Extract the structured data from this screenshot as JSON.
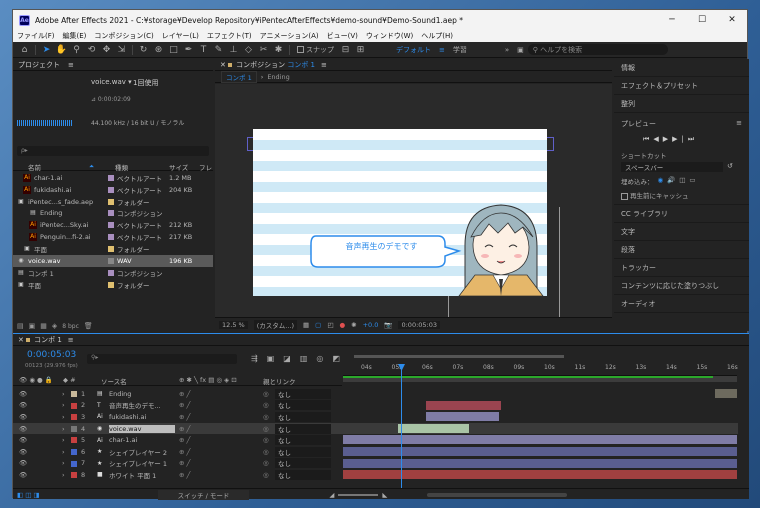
{
  "window": {
    "title": "Adobe After Effects 2021 - C:¥storage¥Develop Repository¥iPentecAfterEffects¥demo-sound¥Demo-Sound1.aep *",
    "app_badge": "Ae",
    "minimize": "─",
    "maximize": "☐",
    "close": "✕"
  },
  "menu": [
    "ファイル(F)",
    "編集(E)",
    "コンポジション(C)",
    "レイヤー(L)",
    "エフェクト(T)",
    "アニメーション(A)",
    "ビュー(V)",
    "ウィンドウ(W)",
    "ヘルプ(H)"
  ],
  "toolbar": {
    "snap": "スナップ",
    "workspace_default": "デフォルト",
    "workspace_learn": "学習",
    "search_placeholder": "ヘルプを検索",
    "more": "»"
  },
  "project": {
    "title": "プロジェクト",
    "selected_name": "voice.wav ▾",
    "usage": "1回使用",
    "duration": "⊿ 0:00:02:09",
    "audio_info": "44.100 kHz / 16 bit U / モノラル",
    "search_icon_label": "ρ▸",
    "columns": {
      "name": "名前",
      "type": "種類",
      "size": "サイズ",
      "fr": "フレ"
    },
    "items": [
      {
        "name": "char-1.ai",
        "type": "ベクトルアート",
        "size": "1.2 MB",
        "color": "#a98fbf",
        "icon": "Ai",
        "indent": 1
      },
      {
        "name": "fukidashi.ai",
        "type": "ベクトルアート",
        "size": "204 KB",
        "color": "#a98fbf",
        "icon": "Ai",
        "indent": 1
      },
      {
        "name": "iPentec...s_fade.aep",
        "type": "フォルダー",
        "size": "",
        "color": "#e0c070",
        "icon": "▣",
        "indent": 0
      },
      {
        "name": "Ending",
        "type": "コンポジション",
        "size": "",
        "color": "#a98fbf",
        "icon": "▤",
        "indent": 2
      },
      {
        "name": "iPentec...Sky.ai",
        "type": "ベクトルアート",
        "size": "212 KB",
        "color": "#a98fbf",
        "icon": "Ai",
        "indent": 2
      },
      {
        "name": "Penguin...fi-2.ai",
        "type": "ベクトルアート",
        "size": "217 KB",
        "color": "#a98fbf",
        "icon": "Ai",
        "indent": 2
      },
      {
        "name": "平面",
        "type": "フォルダー",
        "size": "",
        "color": "#e0c070",
        "icon": "▣",
        "indent": 1
      },
      {
        "name": "voice.wav",
        "type": "WAV",
        "size": "196 KB",
        "color": "#888",
        "icon": "◉",
        "indent": 0,
        "selected": true
      },
      {
        "name": "コンポ 1",
        "type": "コンポジション",
        "size": "",
        "color": "#a98fbf",
        "icon": "▤",
        "indent": 0
      },
      {
        "name": "平面",
        "type": "フォルダー",
        "size": "",
        "color": "#e0c070",
        "icon": "▣",
        "indent": 0
      }
    ],
    "bpc": "8 bpc"
  },
  "comp": {
    "tab_label": "コンポジション",
    "tab_name": "コンポ 1",
    "breadcrumb_active": "コンポ 1",
    "breadcrumb_next": "Ending",
    "speech_text": "音声再生のデモです",
    "zoom": "12.5 %",
    "view": "(カスタム...)",
    "exposure": "+0.0",
    "timecode": "0:00:05:03"
  },
  "right_panels": [
    "情報",
    "エフェクト＆プリセット",
    "整列",
    "プレビュー",
    "ショートカット",
    "CC ライブラリ",
    "文字",
    "段落",
    "トラッカー",
    "コンテンツに応じた塗りつぶし",
    "オーディオ"
  ],
  "preview": {
    "shortcut_label": "ショートカット",
    "shortcut_value": "スペースバー",
    "include_label": "埋め込み：",
    "cache_label": "再生前にキャッシュ"
  },
  "timeline": {
    "tab": "コンポ 1",
    "timecode": "0:00:05:03",
    "fps": "00123 (29.976 fps)",
    "col_source": "ソース名",
    "col_parent": "親とリンク",
    "footer": "スイッチ / モード",
    "ruler": [
      "04s",
      "05s",
      "06s",
      "07s",
      "08s",
      "09s",
      "10s",
      "11s",
      "12s",
      "13s",
      "14s",
      "15s",
      "16s"
    ],
    "layers": [
      {
        "num": "1",
        "name": "Ending",
        "label": "#c8b89a",
        "icon": "▤",
        "parent": "なし",
        "bar_color": "#6d6a5e",
        "start": 0.945,
        "end": 1.0,
        "selected": false
      },
      {
        "num": "2",
        "name": "音声再生のデモ...",
        "label": "#c84040",
        "icon": "T",
        "parent": "なし",
        "bar_color": "#9a4450",
        "start": 0.21,
        "end": 0.4,
        "selected": false
      },
      {
        "num": "3",
        "name": "fukidashi.ai",
        "label": "#c84040",
        "icon": "Ai",
        "parent": "なし",
        "bar_color": "#7f7ca6",
        "start": 0.21,
        "end": 0.395,
        "selected": false
      },
      {
        "num": "4",
        "name": "voice.wav",
        "label": "#777777",
        "icon": "◉",
        "parent": "なし",
        "bar_color": "#a9c4a6",
        "start": 0.14,
        "end": 0.32,
        "selected": true
      },
      {
        "num": "5",
        "name": "char-1.ai",
        "label": "#c84040",
        "icon": "Ai",
        "parent": "なし",
        "bar_color": "#7f7ca6",
        "start": 0.0,
        "end": 1.0,
        "selected": false
      },
      {
        "num": "6",
        "name": "シェイプレイヤー 2",
        "label": "#4466cc",
        "icon": "★",
        "parent": "なし",
        "bar_color": "#5a5e90",
        "start": 0.0,
        "end": 1.0,
        "selected": false
      },
      {
        "num": "7",
        "name": "シェイプレイヤー 1",
        "label": "#4466cc",
        "icon": "★",
        "parent": "なし",
        "bar_color": "#5a5e90",
        "start": 0.0,
        "end": 1.0,
        "selected": false
      },
      {
        "num": "8",
        "name": "ホワイト 平面 1",
        "label": "#c84040",
        "icon": "■",
        "parent": "なし",
        "bar_color": "#a04040",
        "start": 0.0,
        "end": 1.0,
        "selected": false
      }
    ]
  }
}
